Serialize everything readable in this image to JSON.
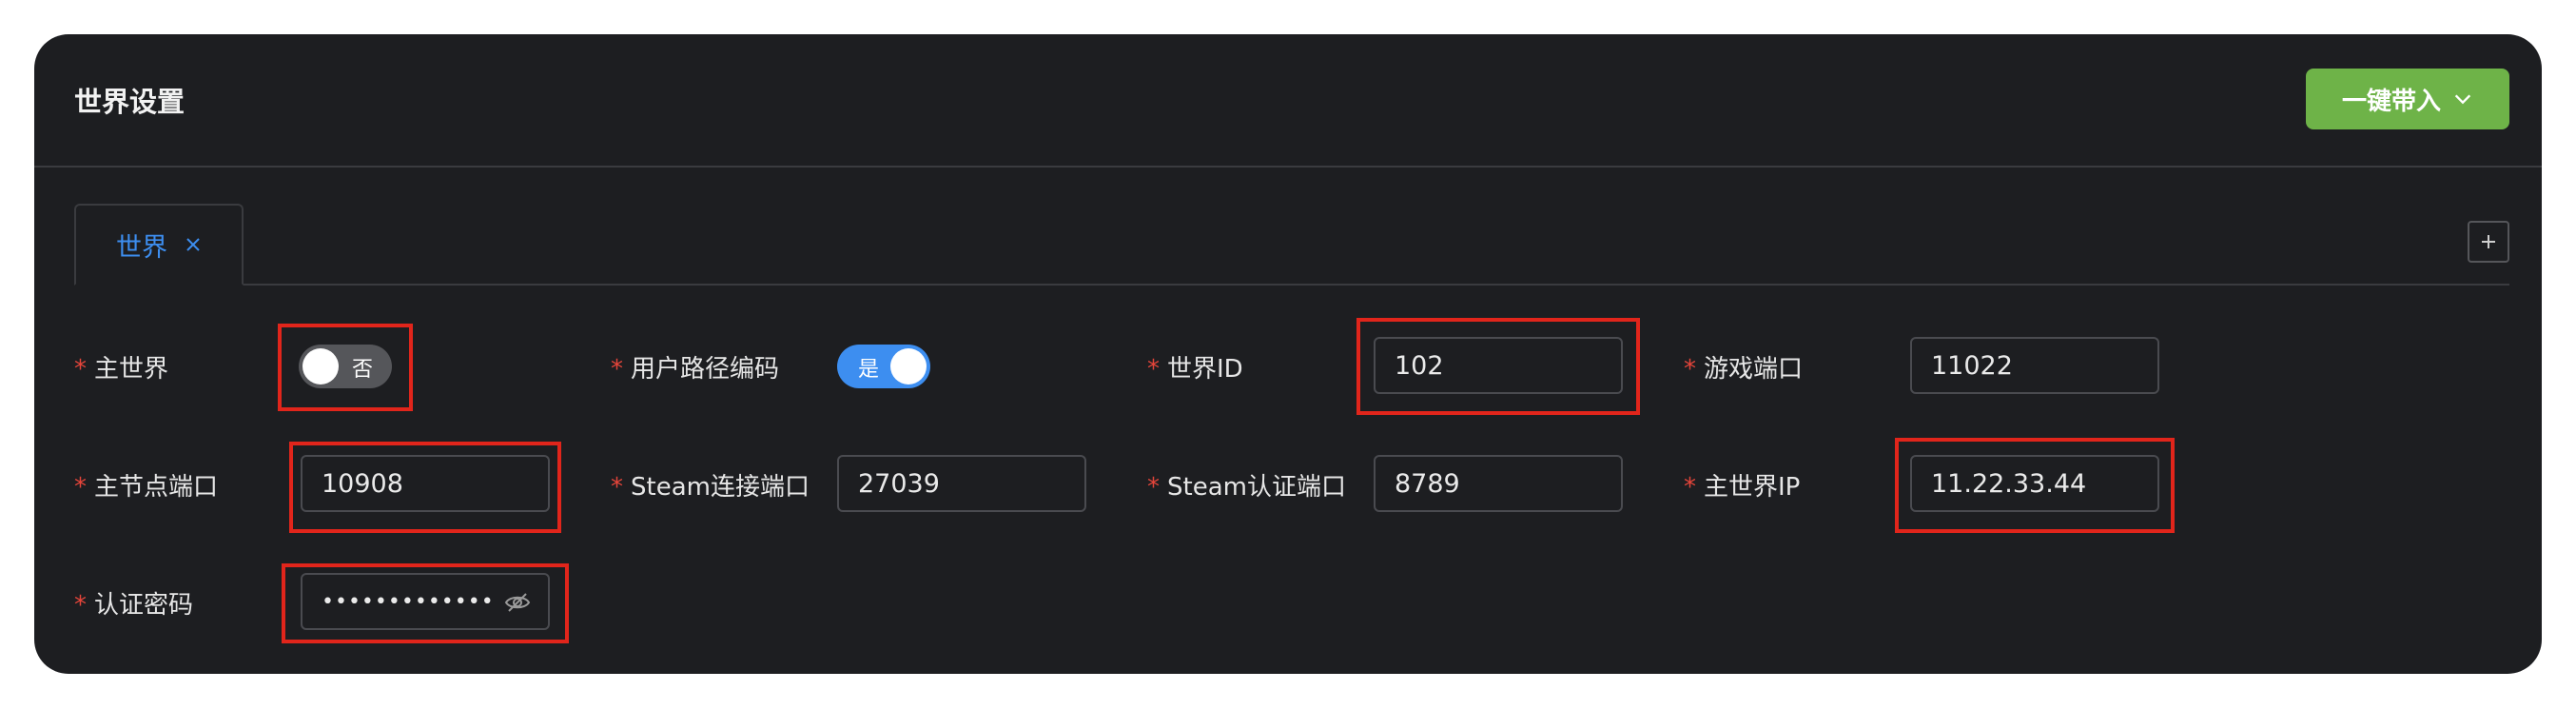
{
  "header": {
    "title": "世界设置",
    "bring_button_label": "一键带入"
  },
  "tabs": [
    {
      "label": "世界",
      "active": true
    }
  ],
  "fields": {
    "main_world": {
      "label": "主世界",
      "switch_text": "否",
      "checked": false
    },
    "user_path_encoding": {
      "label": "用户路径编码",
      "switch_text": "是",
      "checked": true
    },
    "world_id": {
      "label": "世界ID",
      "value": "102"
    },
    "game_port": {
      "label": "游戏端口",
      "value": "11022"
    },
    "master_node_port": {
      "label": "主节点端口",
      "value": "10908"
    },
    "steam_connect_port": {
      "label": "Steam连接端口",
      "value": "27039"
    },
    "steam_auth_port": {
      "label": "Steam认证端口",
      "value": "8789"
    },
    "main_world_ip": {
      "label": "主世界IP",
      "value": "11.22.33.44"
    },
    "auth_password": {
      "label": "认证密码",
      "value": "••••••••••••••"
    }
  },
  "required_mark": "*",
  "colors": {
    "background": "#1d1e21",
    "accent": "#3d8ef0",
    "bring_button": "#6eb348",
    "required": "#e5453a",
    "highlight": "#e1251b"
  },
  "icons": [
    "close-icon",
    "plus-icon",
    "chevron-down-icon",
    "eye-off-icon"
  ]
}
